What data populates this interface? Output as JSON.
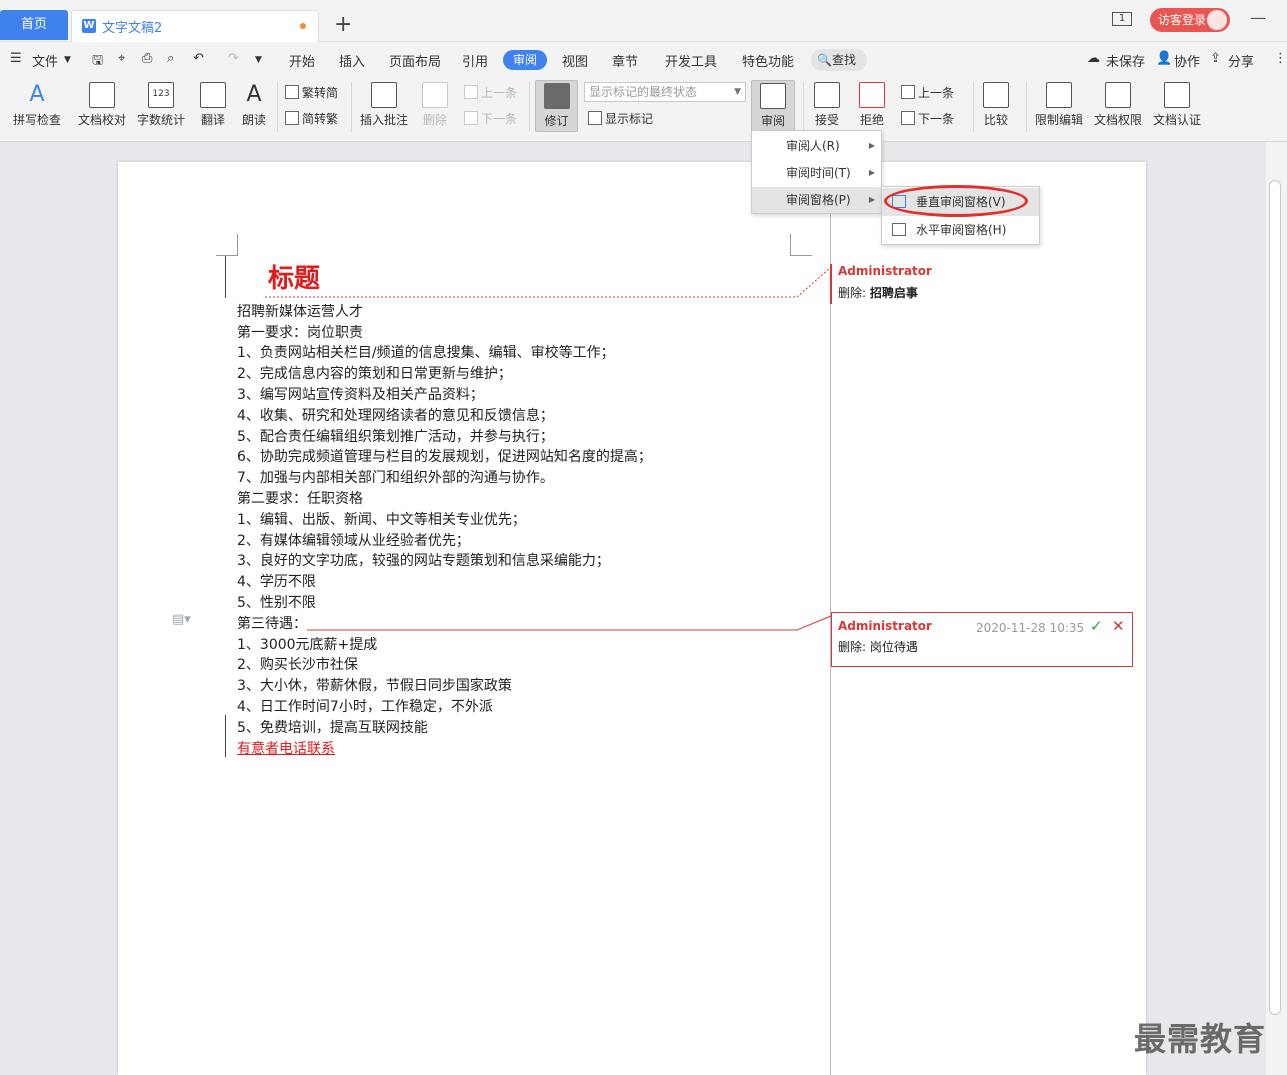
{
  "titlebar": {
    "home_tab": "首页",
    "doc_tab": "文字文稿2",
    "doc_icon": "W",
    "page_indicator": "1",
    "visitor_login": "访客登录"
  },
  "menu": {
    "file": "文件",
    "tabs": [
      "开始",
      "插入",
      "页面布局",
      "引用",
      "审阅",
      "视图",
      "章节",
      "开发工具",
      "特色功能"
    ],
    "active_tab": "审阅",
    "search": "查找",
    "unsaved": "未保存",
    "collaborate": "协作",
    "share": "分享"
  },
  "ribbon": {
    "spell_check": "拼写检查",
    "doc_proof": "文档校对",
    "word_count": "字数统计",
    "translate": "翻译",
    "read_aloud": "朗读",
    "trad_to_simp": "繁转简",
    "simp_to_trad": "简转繁",
    "insert_comment": "插入批注",
    "delete": "删除",
    "prev_comment": "上一条",
    "next_comment": "下一条",
    "track_changes": "修订",
    "markup_state": "显示标记的最终状态",
    "show_markup": "显示标记",
    "review": "审阅",
    "accept": "接受",
    "reject": "拒绝",
    "prev": "上一条",
    "next": "下一条",
    "compare": "比较",
    "restrict_edit": "限制编辑",
    "doc_permission": "文档权限",
    "doc_cert": "文档认证"
  },
  "review_menu": {
    "items": [
      "审阅人(R)",
      "审阅时间(T)",
      "审阅窗格(P)"
    ]
  },
  "pane_submenu": {
    "items": [
      "垂直审阅窗格(V)",
      "水平审阅窗格(H)"
    ]
  },
  "document": {
    "title": "标题",
    "lines": [
      "招聘新媒体运营人才",
      "第一要求：岗位职责",
      "1、负责网站相关栏目/频道的信息搜集、编辑、审校等工作；",
      "2、完成信息内容的策划和日常更新与维护；",
      "3、编写网站宣传资料及相关产品资料；",
      "4、收集、研究和处理网络读者的意见和反馈信息；",
      "5、配合责任编辑组织策划推广活动，并参与执行；",
      "6、协助完成频道管理与栏目的发展规划，促进网站知名度的提高；",
      "7、加强与内部相关部门和组织外部的沟通与协作。",
      "第二要求：任职资格",
      "1、编辑、出版、新闻、中文等相关专业优先；",
      "2、有媒体编辑领域从业经验者优先；",
      "3、良好的文字功底，较强的网站专题策划和信息采编能力；",
      "4、学历不限",
      "5、性别不限",
      "第三待遇：",
      "1、3000元底薪+提成",
      "2、购买长沙市社保",
      "3、大小休，带薪休假，节假日同步国家政策",
      "4、日工作时间7小时，工作稳定，不外派",
      "5、免费培训，提高互联网技能"
    ],
    "inserted_line": "有意者电话联系"
  },
  "comments": [
    {
      "author": "Administrator",
      "label": "删除:",
      "text": "招聘启事"
    },
    {
      "author": "Administrator",
      "time": "2020-11-28 10:35",
      "label": "删除:",
      "text": "岗位待遇"
    }
  ],
  "watermark": "最需教育",
  "colors": {
    "accent": "#3f82ee",
    "revision": "#e21b1b",
    "comment": "#d63838"
  }
}
